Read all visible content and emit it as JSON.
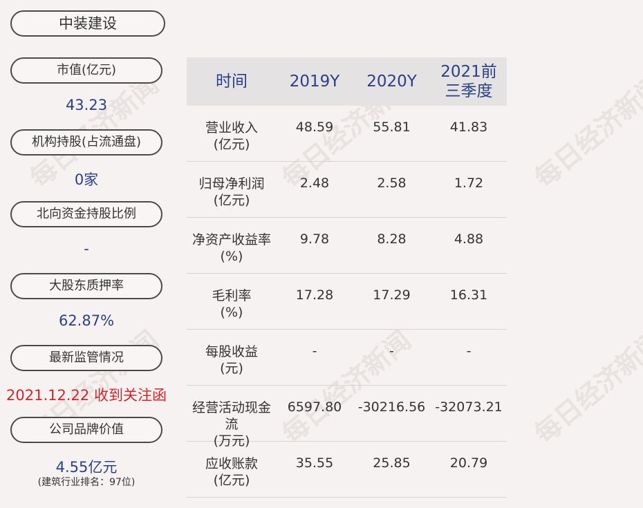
{
  "company_name": "中装建设",
  "watermark_text": "每日经济新闻",
  "metrics": [
    {
      "label": "市值(亿元)",
      "value": "43.23"
    },
    {
      "label": "机构持股(占流通盘)",
      "value": "0家"
    },
    {
      "label": "北向资金持股比例",
      "value": "-"
    },
    {
      "label": "大股东质押率",
      "value": "62.87%"
    },
    {
      "label": "最新监管情况",
      "value": "2021.12.22 收到关注函",
      "highlight_color": "#d0252c"
    },
    {
      "label": "公司品牌价值",
      "value": "4.55亿元",
      "note": "(建筑行业排名：97位)"
    }
  ],
  "table": {
    "headers": [
      "时间",
      "2019Y",
      "2020Y",
      "2021前三季度"
    ],
    "rows": [
      {
        "name": "营业收入",
        "unit": "(亿元)",
        "values": [
          "48.59",
          "55.81",
          "41.83"
        ]
      },
      {
        "name": "归母净利润",
        "unit": "(亿元)",
        "values": [
          "2.48",
          "2.58",
          "1.72"
        ]
      },
      {
        "name": "净资产收益率",
        "unit": "(%)",
        "values": [
          "9.78",
          "8.28",
          "4.88"
        ]
      },
      {
        "name": "毛利率",
        "unit": "(%)",
        "values": [
          "17.28",
          "17.29",
          "16.31"
        ]
      },
      {
        "name": "每股收益",
        "unit": "(元)",
        "values": [
          "-",
          "-",
          "-"
        ]
      },
      {
        "name": "经营活动现金流",
        "unit": "(万元)",
        "values": [
          "6597.80",
          "-30216.56",
          "-32073.21"
        ]
      },
      {
        "name": "应收账款",
        "unit": "(亿元)",
        "values": [
          "35.55",
          "25.85",
          "20.79"
        ]
      }
    ]
  },
  "colors": {
    "accent_blue": "#2b3f86",
    "alert_red": "#d0252c",
    "background": "#f6f2f1",
    "header_bg": "#e4e2e3"
  }
}
